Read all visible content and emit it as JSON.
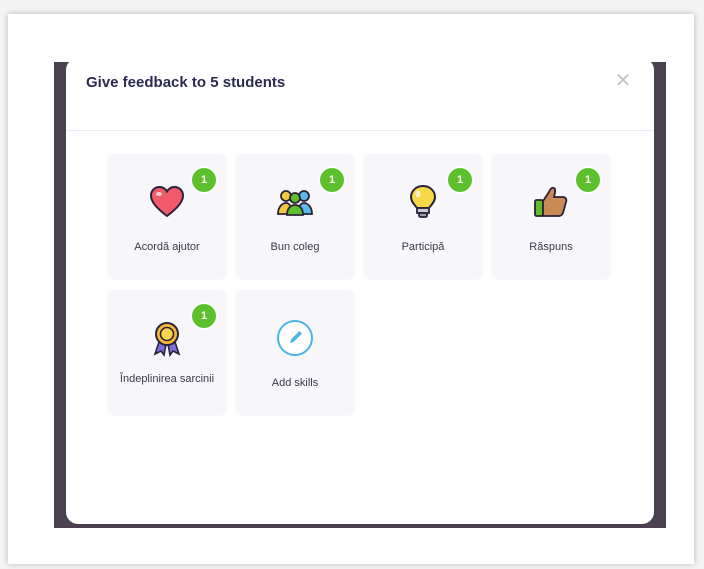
{
  "modal": {
    "title": "Give feedback to 5 students",
    "close_glyph": "✕"
  },
  "skills": [
    {
      "label": "Acordă ajutor",
      "count": "1",
      "icon": "heart-icon"
    },
    {
      "label": "Bun coleg",
      "count": "1",
      "icon": "teamwork-icon"
    },
    {
      "label": "Participă",
      "count": "1",
      "icon": "lightbulb-icon"
    },
    {
      "label": "Răspuns",
      "count": "1",
      "icon": "thumbs-up-icon"
    },
    {
      "label": "Îndeplinirea sarcinii",
      "count": "1",
      "icon": "medal-icon"
    }
  ],
  "add_skills": {
    "label": "Add skills",
    "icon": "pencil-icon"
  },
  "colors": {
    "badge_green": "#5cc02c",
    "title_text": "#2c2a50",
    "backdrop": "#4a4050",
    "card_bg": "#f7f7fb"
  }
}
